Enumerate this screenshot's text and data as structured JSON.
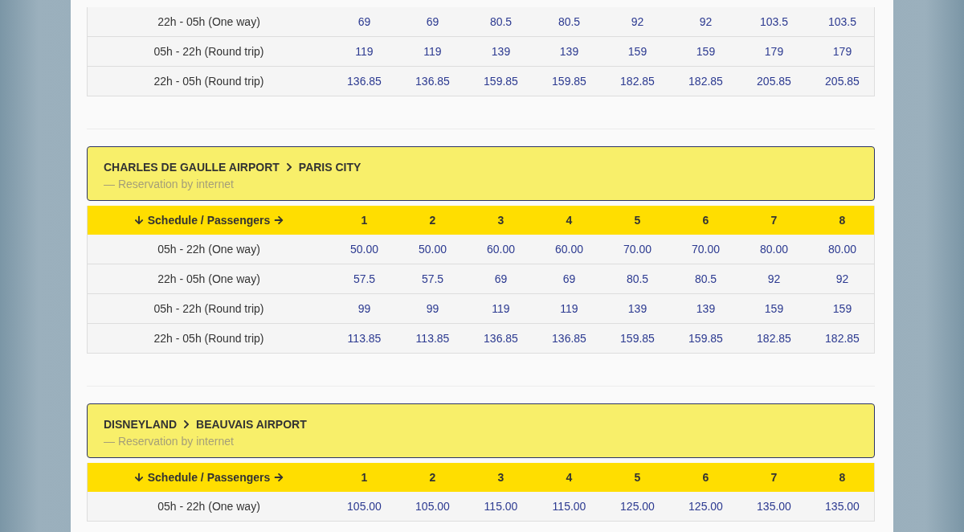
{
  "sections": [
    {
      "rows": [
        {
          "schedule": "22h - 05h (One way)",
          "prices": [
            "69",
            "69",
            "80.5",
            "80.5",
            "92",
            "92",
            "103.5",
            "103.5"
          ]
        },
        {
          "schedule": "05h - 22h (Round trip)",
          "prices": [
            "119",
            "119",
            "139",
            "139",
            "159",
            "159",
            "179",
            "179"
          ]
        },
        {
          "schedule": "22h - 05h (Round trip)",
          "prices": [
            "136.85",
            "136.85",
            "159.85",
            "159.85",
            "182.85",
            "182.85",
            "205.85",
            "205.85"
          ]
        }
      ]
    },
    {
      "route": {
        "from": "CHARLES DE GAULLE AIRPORT",
        "to": "PARIS CITY",
        "note": "— Reservation by internet"
      },
      "header": {
        "label": "Schedule / Passengers",
        "passengers": [
          "1",
          "2",
          "3",
          "4",
          "5",
          "6",
          "7",
          "8"
        ]
      },
      "rows": [
        {
          "schedule": "05h - 22h (One way)",
          "prices": [
            "50.00",
            "50.00",
            "60.00",
            "60.00",
            "70.00",
            "70.00",
            "80.00",
            "80.00"
          ]
        },
        {
          "schedule": "22h - 05h (One way)",
          "prices": [
            "57.5",
            "57.5",
            "69",
            "69",
            "80.5",
            "80.5",
            "92",
            "92"
          ]
        },
        {
          "schedule": "05h - 22h (Round trip)",
          "prices": [
            "99",
            "99",
            "119",
            "119",
            "139",
            "139",
            "159",
            "159"
          ]
        },
        {
          "schedule": "22h - 05h (Round trip)",
          "prices": [
            "113.85",
            "113.85",
            "136.85",
            "136.85",
            "159.85",
            "159.85",
            "182.85",
            "182.85"
          ]
        }
      ]
    },
    {
      "route": {
        "from": "DISNEYLAND",
        "to": "BEAUVAIS AIRPORT",
        "note": "— Reservation by internet"
      },
      "header": {
        "label": "Schedule / Passengers",
        "passengers": [
          "1",
          "2",
          "3",
          "4",
          "5",
          "6",
          "7",
          "8"
        ]
      },
      "rows": [
        {
          "schedule": "05h - 22h (One way)",
          "prices": [
            "105.00",
            "105.00",
            "115.00",
            "115.00",
            "125.00",
            "125.00",
            "135.00",
            "135.00"
          ]
        }
      ]
    }
  ]
}
